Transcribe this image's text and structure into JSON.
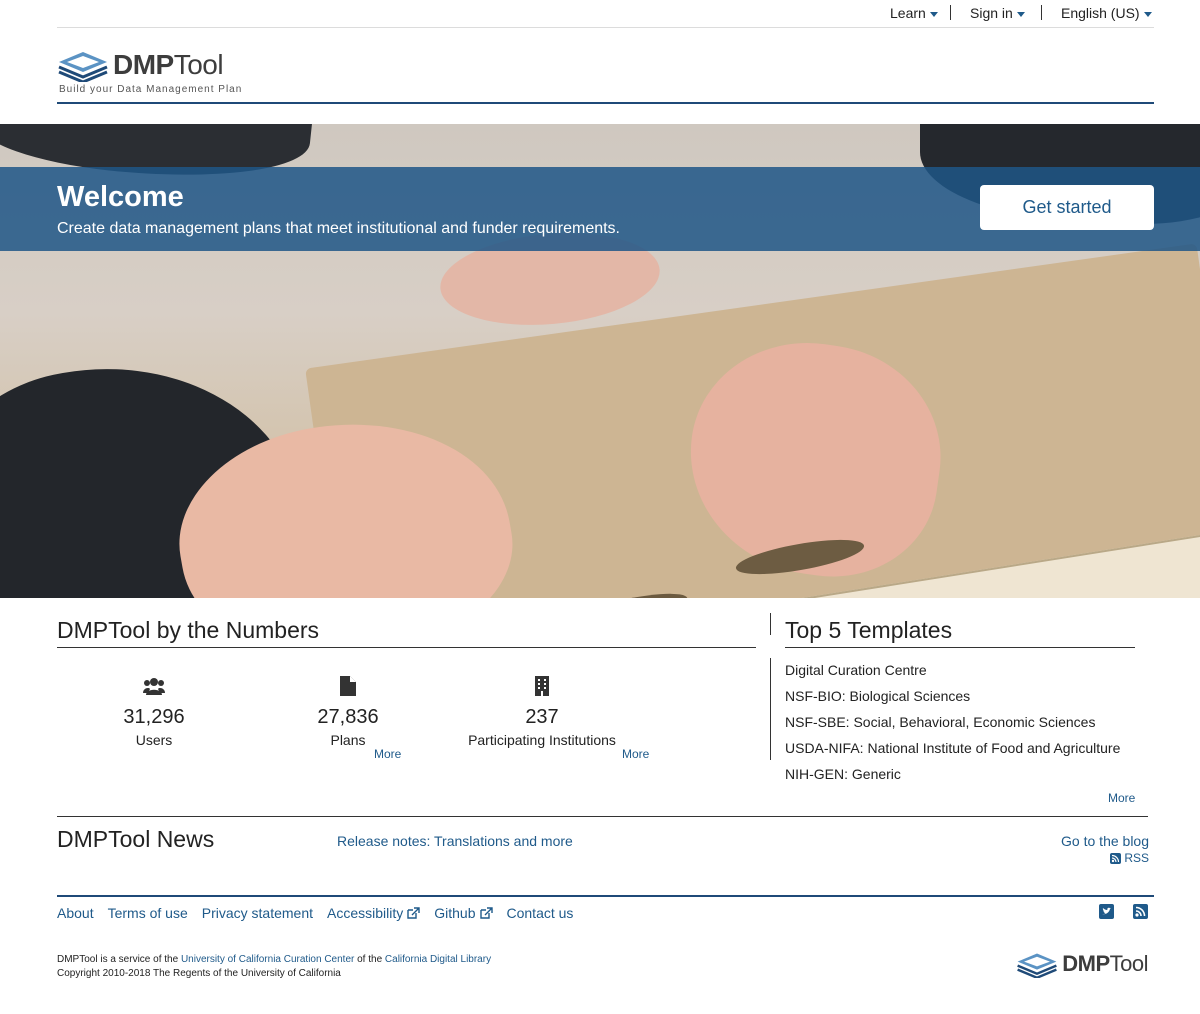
{
  "topnav": {
    "learn": "Learn",
    "sign_in": "Sign in",
    "language": "English (US)"
  },
  "brand": {
    "name_bold": "DMP",
    "name_light": "Tool",
    "tagline": "Build your Data Management Plan"
  },
  "hero": {
    "title": "Welcome",
    "subtitle": "Create data management plans that meet institutional and funder requirements.",
    "cta": "Get started"
  },
  "numbers": {
    "title": "DMPTool by the Numbers",
    "stats": [
      {
        "value": "31,296",
        "label": "Users",
        "icon": "users-icon"
      },
      {
        "value": "27,836",
        "label": "Plans",
        "icon": "file-icon"
      },
      {
        "value": "237",
        "label": "Participating Institutions",
        "icon": "building-icon"
      }
    ],
    "more_plans": "More",
    "more_institutions": "More"
  },
  "templates": {
    "title": "Top 5 Templates",
    "items": [
      "Digital Curation Centre",
      "NSF-BIO: Biological Sciences",
      "NSF-SBE: Social, Behavioral, Economic Sciences",
      "USDA-NIFA: National Institute of Food and Agriculture",
      "NIH-GEN: Generic"
    ],
    "more": "More"
  },
  "news": {
    "title": "DMPTool News",
    "latest": "Release notes: Translations and more",
    "blog": "Go to the blog",
    "rss": "RSS"
  },
  "footer": {
    "links": [
      "About",
      "Terms of use",
      "Privacy statement",
      "Accessibility",
      "Github",
      "Contact us"
    ],
    "service_prefix": "DMPTool is a service of the ",
    "service_org1": "University of California Curation Center",
    "service_mid": " of the ",
    "service_org2": "California Digital Library",
    "copyright": "Copyright 2010-2018 The Regents of the University of California"
  },
  "colors": {
    "primary": "#1f5a8a",
    "banner": "#1f5687",
    "rule": "#1f4a78"
  }
}
